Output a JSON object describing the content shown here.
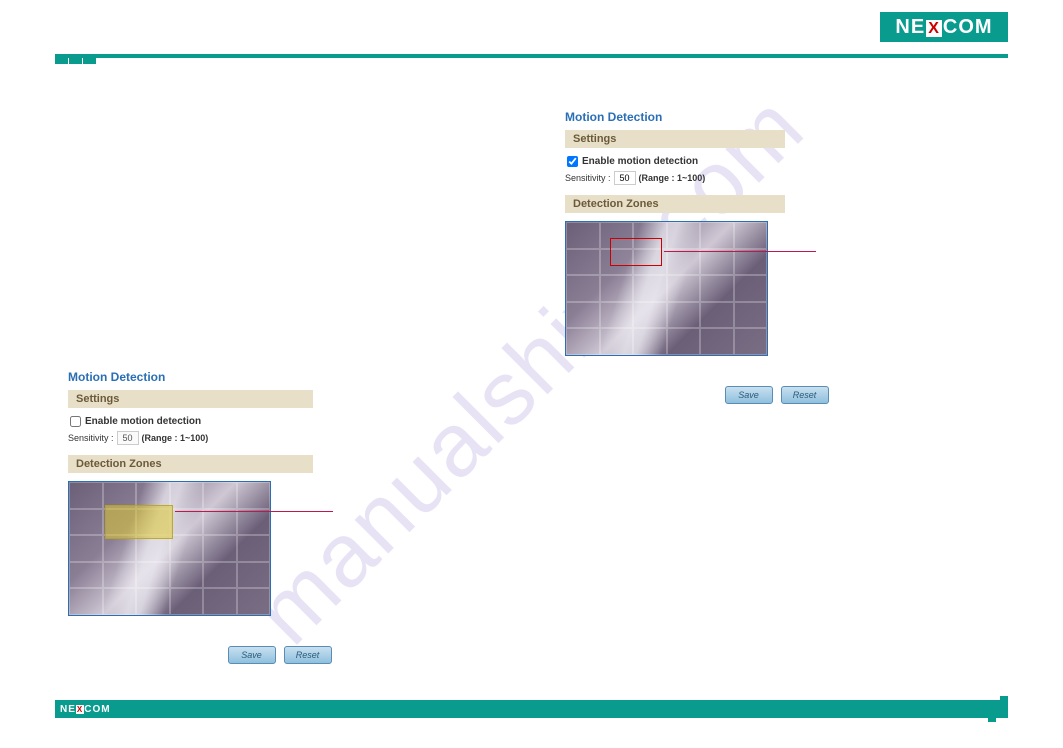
{
  "brand": {
    "name": "NEXCOM"
  },
  "watermark": "manualshive.com",
  "left_panel": {
    "title": "Motion Detection",
    "settings_header": "Settings",
    "enable_label": "Enable motion detection",
    "enable_checked": false,
    "sensitivity_label": "Sensitivity :",
    "sensitivity_value": "50",
    "range_label": "(Range : 1~100)",
    "zones_header": "Detection Zones",
    "save_label": "Save",
    "reset_label": "Reset"
  },
  "right_panel": {
    "title": "Motion Detection",
    "settings_header": "Settings",
    "enable_label": "Enable motion detection",
    "enable_checked": true,
    "sensitivity_label": "Sensitivity :",
    "sensitivity_value": "50",
    "range_label": "(Range : 1~100)",
    "zones_header": "Detection Zones",
    "save_label": "Save",
    "reset_label": "Reset"
  }
}
